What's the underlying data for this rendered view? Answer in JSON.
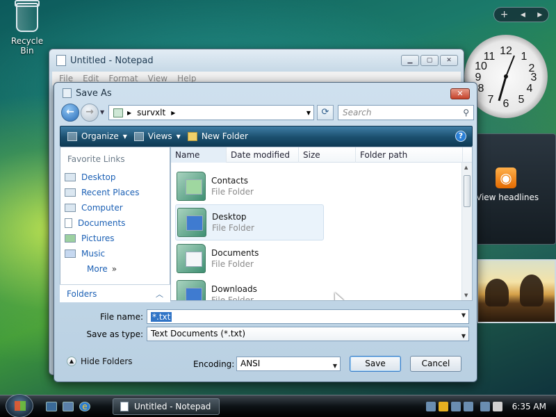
{
  "desktop": {
    "recycle_bin_label": "Recycle Bin",
    "feed_label": "View headlines",
    "sidebar_controls": [
      "+",
      "◂",
      "▸"
    ]
  },
  "notepad": {
    "title": "Untitled - Notepad",
    "menu": [
      "File",
      "Edit",
      "Format",
      "View",
      "Help"
    ]
  },
  "dialog": {
    "title": "Save As",
    "address": {
      "location": "survxlt"
    },
    "search": {
      "placeholder": "Search"
    },
    "toolbar": {
      "organize": "Organize",
      "views": "Views",
      "new_folder": "New Folder"
    },
    "favorite_links": {
      "heading": "Favorite Links",
      "items": [
        {
          "label": "Desktop",
          "icon": "desktop-icon"
        },
        {
          "label": "Recent Places",
          "icon": "recent-places-icon"
        },
        {
          "label": "Computer",
          "icon": "computer-icon"
        },
        {
          "label": "Documents",
          "icon": "documents-icon"
        },
        {
          "label": "Pictures",
          "icon": "pictures-icon"
        },
        {
          "label": "Music",
          "icon": "music-icon"
        }
      ],
      "more": "More"
    },
    "folders_label": "Folders",
    "columns": [
      "Name",
      "Date modified",
      "Size",
      "Folder path"
    ],
    "files": [
      {
        "name": "Contacts",
        "type": "File Folder"
      },
      {
        "name": "Desktop",
        "type": "File Folder",
        "selected": true
      },
      {
        "name": "Documents",
        "type": "File Folder"
      },
      {
        "name": "Downloads",
        "type": "File Folder"
      }
    ],
    "file_name_label": "File name:",
    "file_name_value": "*.txt",
    "save_type_label": "Save as type:",
    "save_type_value": "Text Documents (*.txt)",
    "hide_folders": "Hide Folders",
    "encoding_label": "Encoding:",
    "encoding_value": "ANSI",
    "save_button": "Save",
    "cancel_button": "Cancel"
  },
  "taskbar": {
    "task": "Untitled - Notepad",
    "time": "6:35 AM"
  },
  "colors": {
    "selection": "#3074c6",
    "link": "#1a5fb4",
    "toolbar": "#1b4f6e"
  }
}
